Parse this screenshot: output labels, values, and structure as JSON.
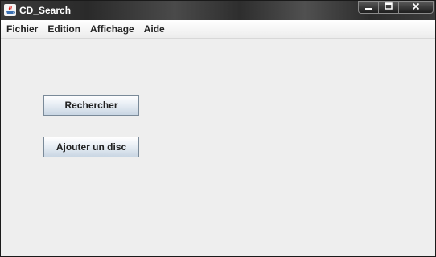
{
  "window": {
    "title": "CD_Search",
    "controls": {
      "minimize_icon": "minimize-icon",
      "maximize_icon": "maximize-icon",
      "close_icon": "close-icon"
    }
  },
  "menubar": {
    "items": [
      {
        "label": "Fichier"
      },
      {
        "label": "Edition"
      },
      {
        "label": "Affichage"
      },
      {
        "label": "Aide"
      }
    ]
  },
  "main": {
    "search_button_label": "Rechercher",
    "add_disc_button_label": "Ajouter un disc"
  },
  "colors": {
    "titlebar": "#2b2b2b",
    "background": "#eeeeee",
    "button_border": "#7a8a99"
  }
}
